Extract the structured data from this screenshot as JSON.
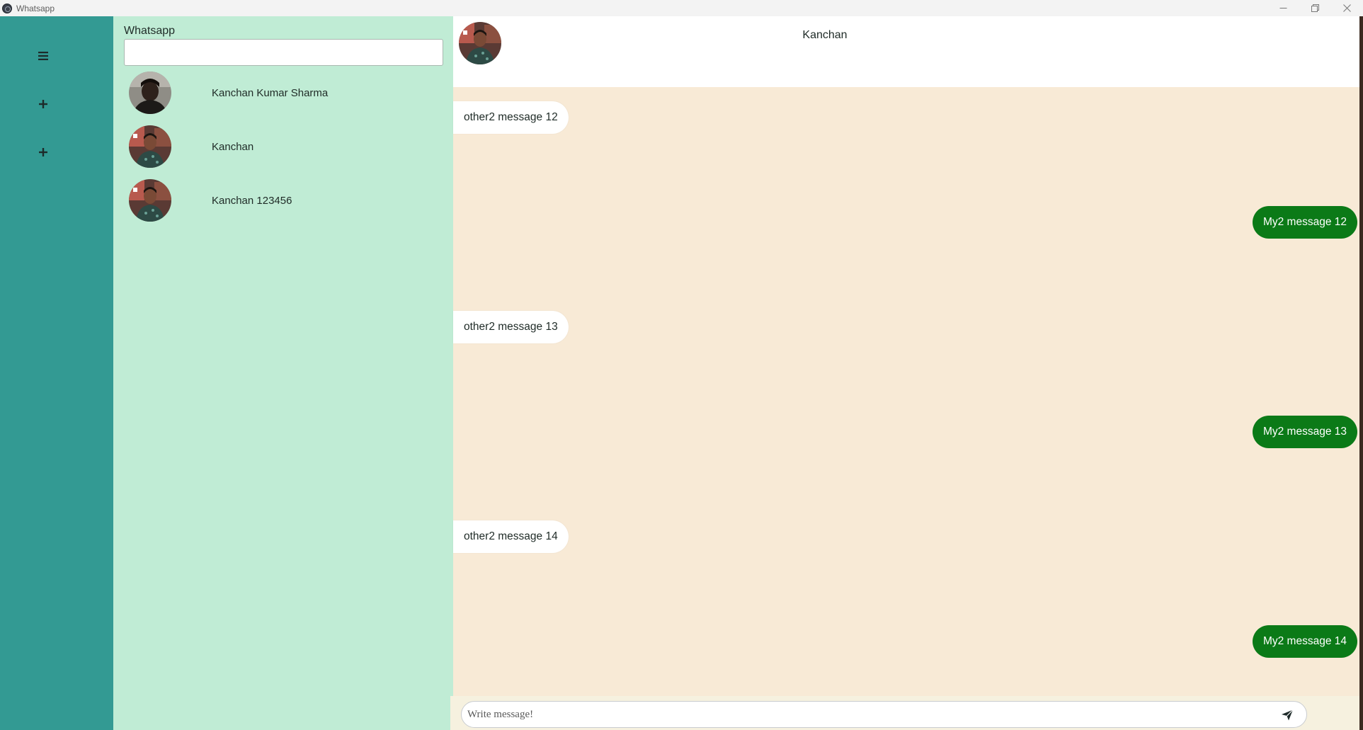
{
  "window": {
    "title": "Whatsapp",
    "app_icon": "app-logo-icon",
    "controls": [
      "minimize-icon",
      "restore-icon",
      "close-icon"
    ]
  },
  "rail": {
    "items": [
      {
        "icon": "hamburger-menu-icon"
      },
      {
        "icon": "plus-icon"
      },
      {
        "icon": "plus-icon"
      }
    ]
  },
  "contacts": {
    "title": "Whatsapp",
    "search": {
      "value": "",
      "placeholder": ""
    },
    "list": [
      {
        "name": "Kanchan Kumar Sharma"
      },
      {
        "name": "Kanchan"
      },
      {
        "name": "Kanchan 123456"
      }
    ]
  },
  "chat": {
    "contact_name": "Kanchan",
    "messages": [
      {
        "direction": "in",
        "text": "other2 message 12"
      },
      {
        "direction": "out",
        "text": "My2 message 12"
      },
      {
        "direction": "in",
        "text": "other2 message 13"
      },
      {
        "direction": "out",
        "text": "My2 message 13"
      },
      {
        "direction": "in",
        "text": "other2 message 14"
      },
      {
        "direction": "out",
        "text": "My2 message 14"
      }
    ],
    "composer": {
      "value": "",
      "placeholder": "Write message!",
      "send_icon": "send-icon"
    }
  },
  "colors": {
    "rail": "#339a93",
    "contacts_bg": "#c0ecd5",
    "chat_bg": "#f8ead6",
    "outgoing_bubble": "#0b7a17",
    "incoming_bubble": "#ffffff"
  }
}
